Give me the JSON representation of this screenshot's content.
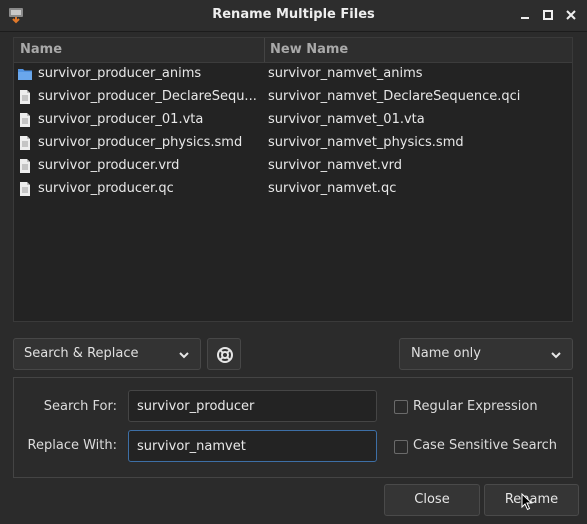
{
  "window": {
    "title": "Rename Multiple Files",
    "icons": [
      "app-icon",
      "minimize-icon",
      "maximize-icon",
      "close-icon"
    ]
  },
  "table": {
    "columns": [
      "Name",
      "New Name"
    ],
    "rows": [
      {
        "type": "folder",
        "name": "survivor_producer_anims",
        "new_name": "survivor_namvet_anims"
      },
      {
        "type": "file",
        "name": "survivor_producer_DeclareSequ...",
        "new_name": "survivor_namvet_DeclareSequence.qci"
      },
      {
        "type": "file",
        "name": "survivor_producer_01.vta",
        "new_name": "survivor_namvet_01.vta"
      },
      {
        "type": "file",
        "name": "survivor_producer_physics.smd",
        "new_name": "survivor_namvet_physics.smd"
      },
      {
        "type": "file",
        "name": "survivor_producer.vrd",
        "new_name": "survivor_namvet.vrd"
      },
      {
        "type": "file",
        "name": "survivor_producer.qc",
        "new_name": "survivor_namvet.qc"
      }
    ]
  },
  "controls": {
    "mode_select": "Search & Replace",
    "scope_select": "Name only"
  },
  "options": {
    "search_label": "Search For:",
    "search_value": "survivor_producer",
    "replace_label": "Replace With:",
    "replace_value": "survivor_namvet",
    "regex_label": "Regular Expression",
    "regex_checked": false,
    "case_label": "Case Sensitive Search",
    "case_checked": false
  },
  "buttons": {
    "close": "Close",
    "rename": "Rename"
  },
  "colors": {
    "background": "#2b2b2b",
    "list_background": "#232323",
    "folder": "#5294e2",
    "focus_border": "#3d6fa6"
  }
}
